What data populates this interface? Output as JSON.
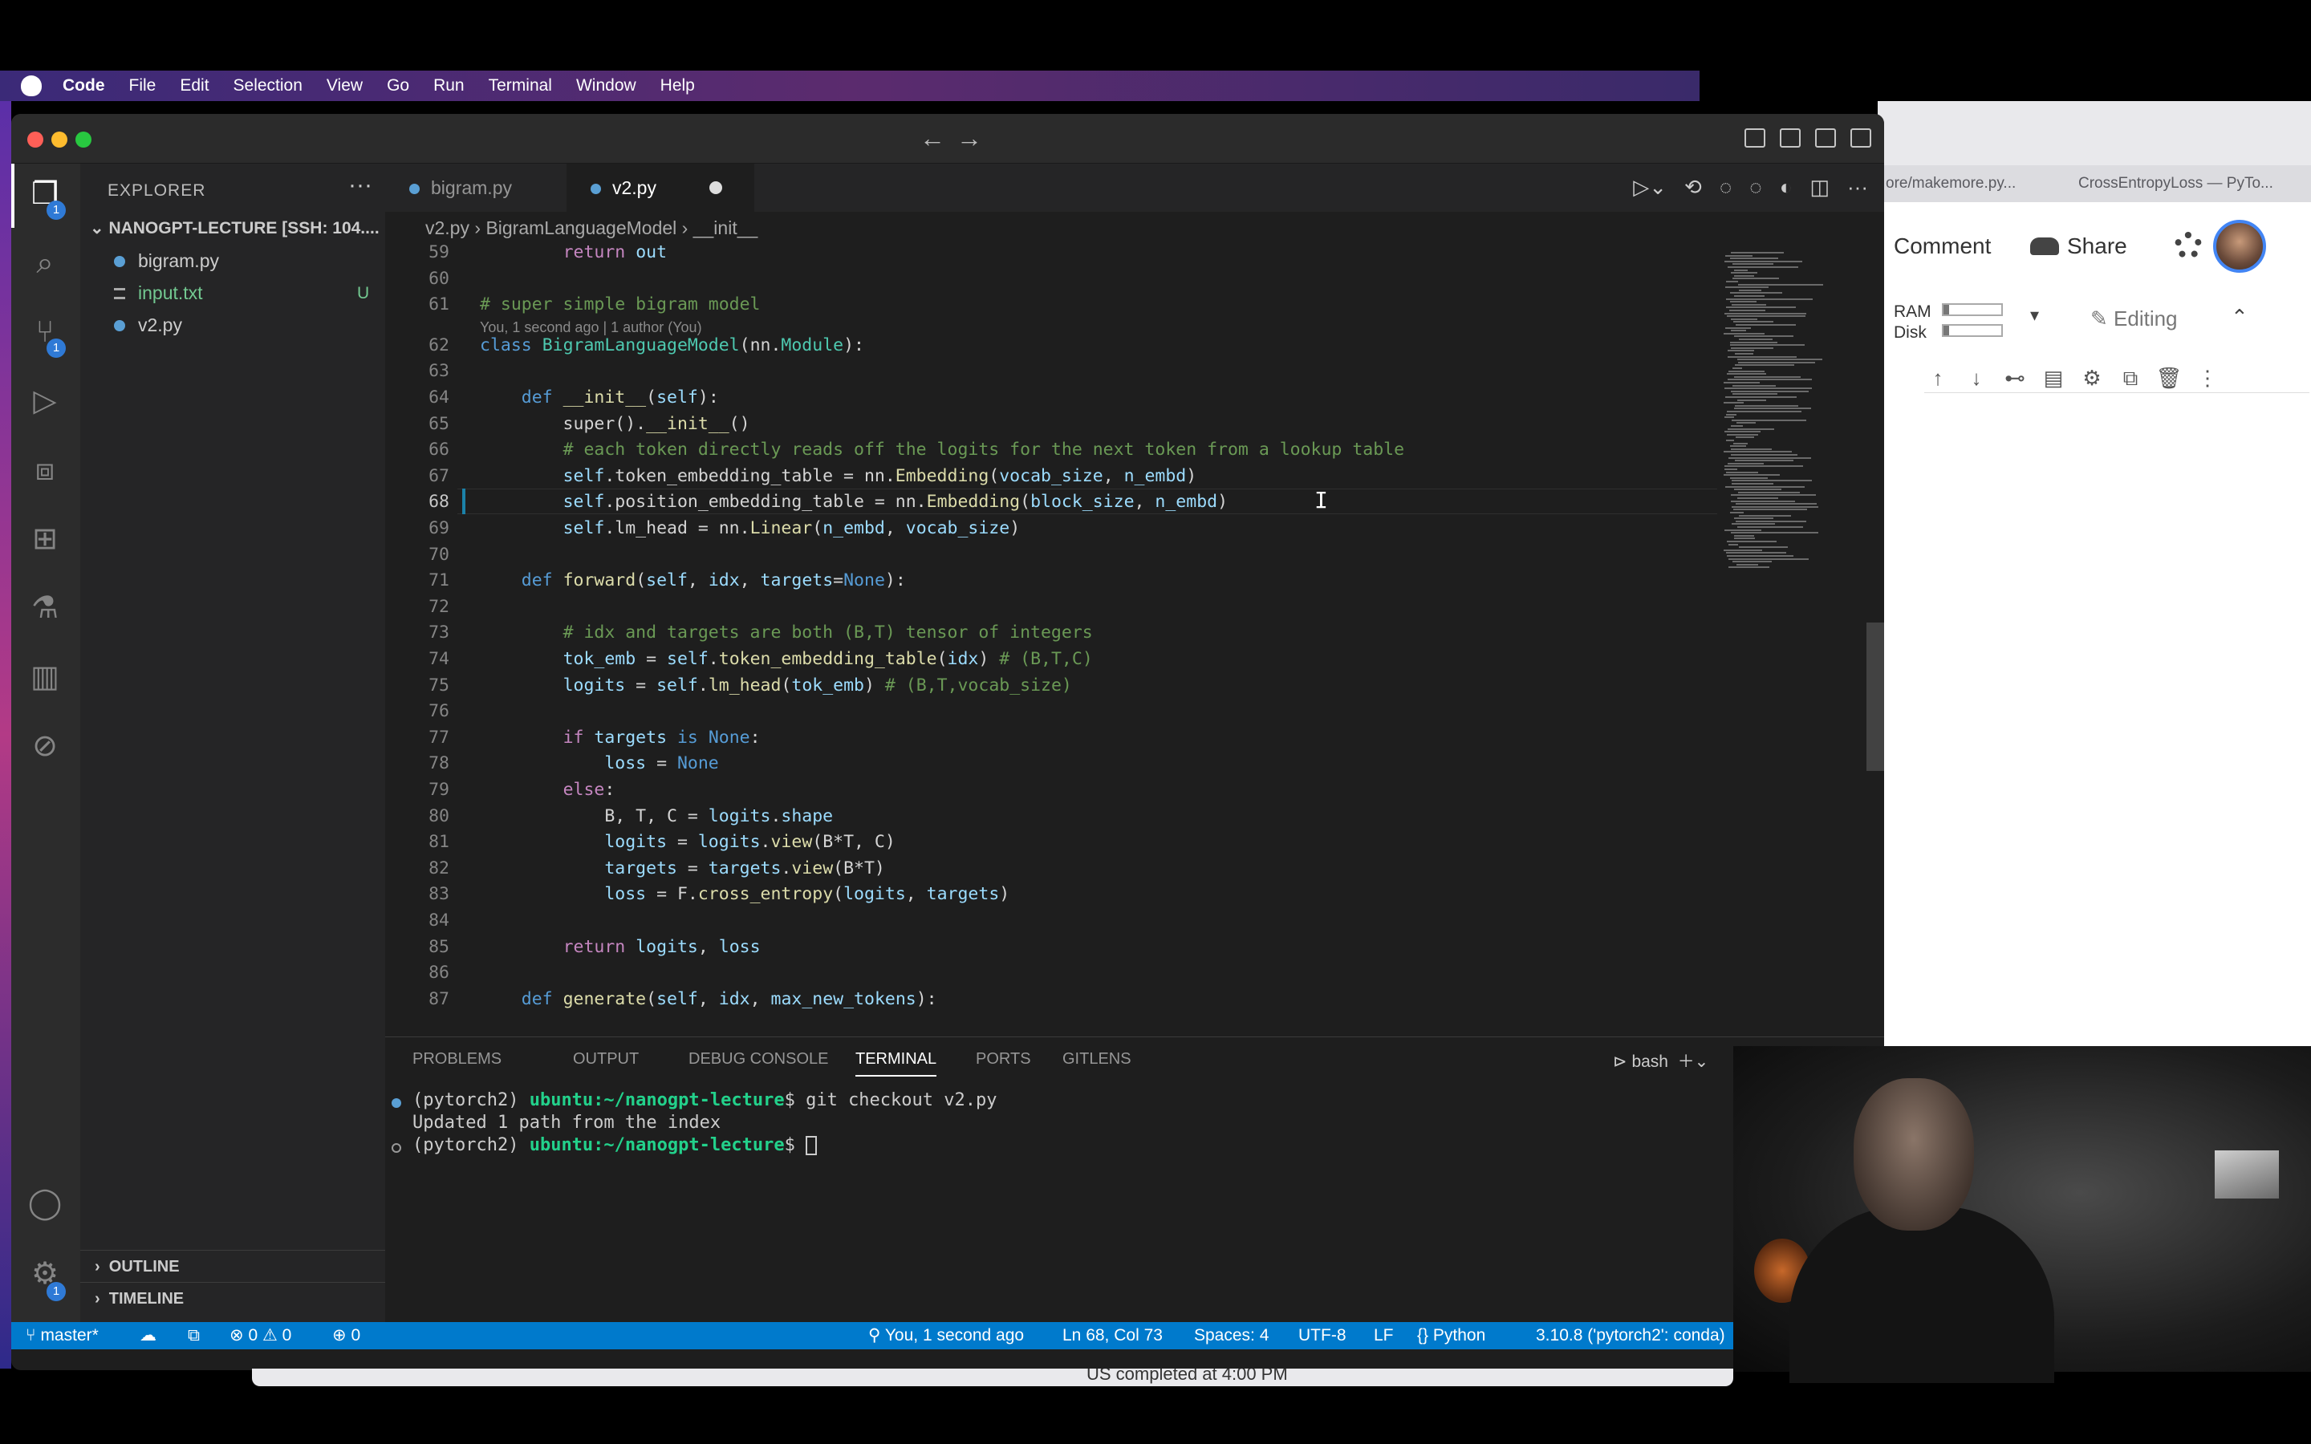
{
  "menubar": {
    "app": "Code",
    "items": [
      "File",
      "Edit",
      "Selection",
      "View",
      "Go",
      "Run",
      "Terminal",
      "Window",
      "Help"
    ]
  },
  "browser": {
    "tabs": [
      "ore/makemore.py...",
      "CrossEntropyLoss — PyTo..."
    ],
    "comment_label": "Comment",
    "share_label": "Share",
    "ram_label": "RAM",
    "disk_label": "Disk",
    "editing_label": "Editing",
    "ram_level": 0.1,
    "disk_level": 0.1,
    "toolbar_icons": [
      "arrow-up-icon",
      "arrow-down-icon",
      "link-icon",
      "comment-icon",
      "settings-icon",
      "mirror-cell-icon",
      "delete-icon",
      "more-icon"
    ]
  },
  "sidebar": {
    "header": "EXPLORER",
    "folder": "NANOGPT-LECTURE [SSH: 104....",
    "files": [
      {
        "name": "bigram.py",
        "status": ""
      },
      {
        "name": "input.txt",
        "status": "U"
      },
      {
        "name": "v2.py",
        "status": ""
      }
    ],
    "outline": "OUTLINE",
    "timeline": "TIMELINE"
  },
  "activity_badges": {
    "explorer": "1",
    "scm": "1",
    "settings": "1"
  },
  "tabs": [
    {
      "label": "bigram.py",
      "active": false
    },
    {
      "label": "v2.py",
      "active": true,
      "modified": true
    }
  ],
  "breadcrumb": {
    "file": "v2.py",
    "class": "BigramLanguageModel",
    "method": "__init__"
  },
  "editor": {
    "blame": "You, 1 second ago | 1 author (You)",
    "lines": [
      {
        "n": "59",
        "t": "        return out"
      },
      {
        "n": "60",
        "t": ""
      },
      {
        "n": "61",
        "t": "# super simple bigram model"
      },
      {
        "n": "62",
        "t": "class BigramLanguageModel(nn.Module):"
      },
      {
        "n": "63",
        "t": ""
      },
      {
        "n": "64",
        "t": "    def __init__(self):"
      },
      {
        "n": "65",
        "t": "        super().__init__()"
      },
      {
        "n": "66",
        "t": "        # each token directly reads off the logits for the next token from a lookup table"
      },
      {
        "n": "67",
        "t": "        self.token_embedding_table = nn.Embedding(vocab_size, n_embd)"
      },
      {
        "n": "68",
        "t": "        self.position_embedding_table = nn.Embedding(block_size, n_embd)"
      },
      {
        "n": "69",
        "t": "        self.lm_head = nn.Linear(n_embd, vocab_size)"
      },
      {
        "n": "70",
        "t": ""
      },
      {
        "n": "71",
        "t": "    def forward(self, idx, targets=None):"
      },
      {
        "n": "72",
        "t": ""
      },
      {
        "n": "73",
        "t": "        # idx and targets are both (B,T) tensor of integers"
      },
      {
        "n": "74",
        "t": "        tok_emb = self.token_embedding_table(idx) # (B,T,C)"
      },
      {
        "n": "75",
        "t": "        logits = self.lm_head(tok_emb) # (B,T,vocab_size)"
      },
      {
        "n": "76",
        "t": ""
      },
      {
        "n": "77",
        "t": "        if targets is None:"
      },
      {
        "n": "78",
        "t": "            loss = None"
      },
      {
        "n": "79",
        "t": "        else:"
      },
      {
        "n": "80",
        "t": "            B, T, C = logits.shape"
      },
      {
        "n": "81",
        "t": "            logits = logits.view(B*T, C)"
      },
      {
        "n": "82",
        "t": "            targets = targets.view(B*T)"
      },
      {
        "n": "83",
        "t": "            loss = F.cross_entropy(logits, targets)"
      },
      {
        "n": "84",
        "t": ""
      },
      {
        "n": "85",
        "t": "        return logits, loss"
      },
      {
        "n": "86",
        "t": ""
      },
      {
        "n": "87",
        "t": "    def generate(self, idx, max_new_tokens):"
      }
    ]
  },
  "panel": {
    "tabs": [
      "PROBLEMS",
      "OUTPUT",
      "DEBUG CONSOLE",
      "TERMINAL",
      "PORTS",
      "GITLENS"
    ],
    "active_tab": "TERMINAL",
    "shell": "bash",
    "terminal": [
      {
        "env": "(pytorch2) ",
        "host": "ubuntu:~/nanogpt-lecture",
        "cmd": "$ git checkout v2.py"
      },
      {
        "env": "Updated 1 path from the index",
        "host": "",
        "cmd": ""
      },
      {
        "env": "(pytorch2) ",
        "host": "ubuntu:~/nanogpt-lecture",
        "cmd": "$ "
      }
    ]
  },
  "statusbar": {
    "branch": "master*",
    "errors": "0",
    "warnings": "0",
    "ports": "0",
    "blame": "You, 1 second ago",
    "position": "Ln 68, Col 73",
    "spaces": "Spaces: 4",
    "encoding": "UTF-8",
    "eol": "LF",
    "language": "Python",
    "interpreter": "3.10.8 ('pytorch2': conda)"
  },
  "below_text": "US        completed at 4:00 PM"
}
